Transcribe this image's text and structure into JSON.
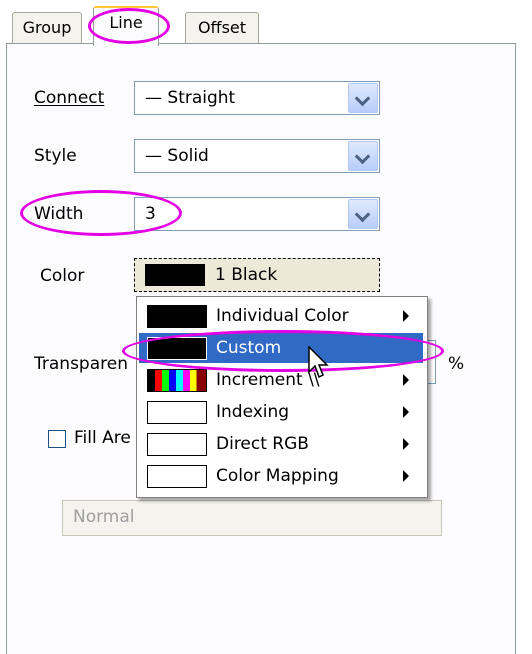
{
  "tabs": [
    {
      "label": "Group"
    },
    {
      "label": "Line"
    },
    {
      "label": "Offset"
    }
  ],
  "fields": {
    "connect": {
      "label": "Connect",
      "value": "Straight"
    },
    "style": {
      "label": "Style",
      "value": "Solid"
    },
    "width": {
      "label": "Width",
      "value": "3"
    },
    "color": {
      "label": "Color",
      "value": "1 Black"
    },
    "transparency": {
      "label": "Transparen",
      "unit": "%"
    },
    "fill_area": {
      "label": "Fill Are"
    },
    "fill_mode": {
      "value": "Normal"
    }
  },
  "color_menu": {
    "items": [
      {
        "label": "Individual Color",
        "has_submenu": true
      },
      {
        "label": "Custom",
        "has_submenu": false,
        "selected": true
      },
      {
        "label": "Increment \\\\",
        "has_submenu": true
      },
      {
        "label": "Indexing",
        "has_submenu": true
      },
      {
        "label": "Direct RGB",
        "has_submenu": true
      },
      {
        "label": "Color Mapping",
        "has_submenu": true
      }
    ]
  },
  "colors": {
    "highlight": "#e400e4",
    "menu_selected": "#316ac5",
    "tab_active_top": "#ffc83c"
  }
}
